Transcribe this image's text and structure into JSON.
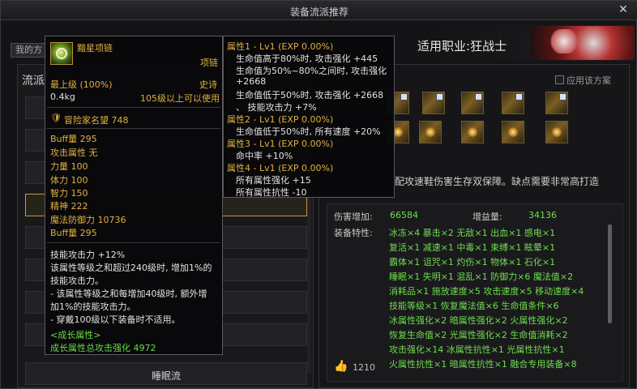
{
  "window": {
    "title": "装备流派推荐",
    "close_glyph": "✕"
  },
  "tab_my": "我的方",
  "job": {
    "label": "适用职业:",
    "value": "狂战士"
  },
  "left": {
    "heading": "流派",
    "selected_row_label": "",
    "bottom_row_label": "睡眠流"
  },
  "right": {
    "apply_label": "应用该方案",
    "description": "配攻速鞋伤害生存双保障。缺点需要非常高打造",
    "damage_label": "伤害增加:",
    "damage_value": "66584",
    "gain_label": "增益量:",
    "gain_value": "34136",
    "traits_label": "装备特性:",
    "traits_lines": [
      "冰冻×4  暴击×2  无敌×1  出血×1  感电×1",
      "复活×1  减速×1  中毒×1  束缚×1  眩晕×1",
      "霸体×1  诅咒×1  灼伤×1  物体×1  石化×1",
      "睡眠×1  失明×1  混乱×1  防御力×6  魔法值×2",
      "消耗品×1  施放速度×5  攻击速度×5  移动速度×4",
      "技能等级×1  恢复魔法值×6  生命值条件×6",
      "冰属性强化×2  暗属性强化×2  火属性强化×2",
      "恢复生命值×2  光属性强化×2  生命值消耗×2",
      "攻击强化×14  冰属性抗性×1  光属性抗性×1",
      "火属性抗性×1  暗属性抗性×1  融合专用装备×8"
    ],
    "likes": "1210"
  },
  "tooltip_item": {
    "name": "黯星项链",
    "slot": "项链",
    "grade_label": "最上级 (100%)",
    "rarity": "史诗",
    "weight": "0.4kg",
    "level_req": "105级以上可以使用",
    "reputation": "冒险家名望 748",
    "stats": [
      "Buff量 295",
      "攻击属性 无",
      "力量 100",
      "体力 100",
      "智力 150",
      "精神 222",
      "魔法防御力 10736",
      "Buff量 295"
    ],
    "effect_lines": [
      "技能攻击力 +12%",
      "该属性等级之和超过240级时, 增加1%的",
      "技能攻击力。",
      "- 该属性等级之和每增加40级时, 额外增",
      "加1%的技能攻击力。",
      "- 穿戴100级以下装备时不适用。"
    ],
    "growth_title": "<成长属性>",
    "growth_total": "成长属性总攻击强化 4972"
  },
  "tooltip_props": {
    "lines": [
      {
        "text": "属性1 - Lv1 (EXP 0.00%)",
        "style": "gold",
        "indent": 0
      },
      {
        "text": "生命值高于80%时, 攻击强化 +445",
        "style": "white",
        "indent": 1
      },
      {
        "text": "生命值为50%~80%之间时, 攻击强化",
        "style": "white",
        "indent": 1
      },
      {
        "text": "+2668",
        "style": "white",
        "indent": 1
      },
      {
        "text": "生命值低于50%时, 攻击强化 +2668",
        "style": "white",
        "indent": 1
      },
      {
        "text": "、 技能攻击力 +7%",
        "style": "white",
        "indent": 1
      },
      {
        "text": "属性2 - Lv1 (EXP 0.00%)",
        "style": "gold",
        "indent": 0
      },
      {
        "text": "生命值低于50%时, 所有速度 +20%",
        "style": "white",
        "indent": 1
      },
      {
        "text": "属性3 - Lv1 (EXP 0.00%)",
        "style": "gold",
        "indent": 0
      },
      {
        "text": "命中率 +10%",
        "style": "white",
        "indent": 1
      },
      {
        "text": "属性4 - Lv1 (EXP 0.00%)",
        "style": "gold",
        "indent": 0
      },
      {
        "text": "所有属性强化 +15",
        "style": "white",
        "indent": 1
      },
      {
        "text": "所有属性抗性 -10",
        "style": "white",
        "indent": 1
      }
    ]
  },
  "icons": {
    "close": "close-icon",
    "checkbox": "checkbox-icon",
    "thumbs_up": "thumbs-up-icon",
    "item": "necklace-icon",
    "reputation": "shield-icon"
  }
}
